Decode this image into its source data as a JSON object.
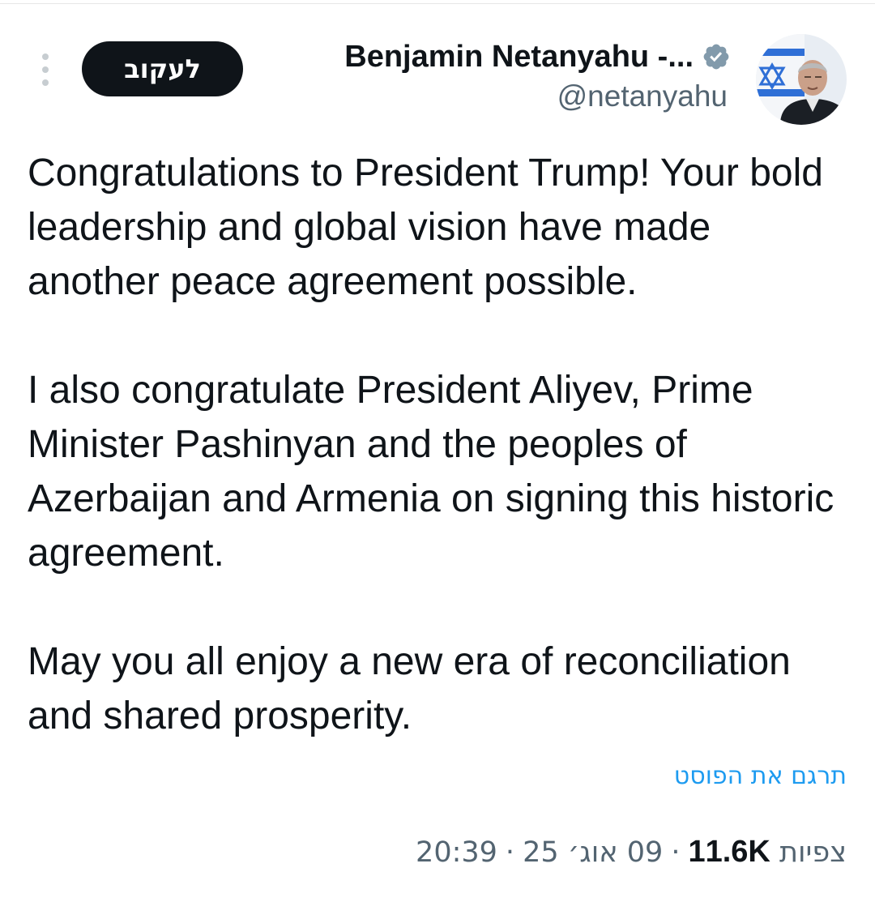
{
  "header": {
    "follow_label": "לעקוב",
    "display_name": "Benjamin Netanyahu -...",
    "handle": "@netanyahu",
    "verified_icon": "verified-badge-icon",
    "more_icon": "more-vertical-icon"
  },
  "tweet": {
    "paragraphs": [
      "Congratulations to President Trump! Your bold leadership and global vision have made another peace agreement possible.",
      "I also congratulate President Aliyev, Prime Minister Pashinyan and the peoples of Azerbaijan and Armenia on signing this historic agreement.",
      "May you all enjoy a new era of reconciliation and shared prosperity."
    ],
    "translate_label": "תרגם את הפוסט"
  },
  "meta": {
    "time": "20:39",
    "date": "09 אוג׳ 25",
    "separator": "·",
    "views_count": "11.6K",
    "views_label": "צפיות"
  },
  "colors": {
    "text": "#0f1419",
    "secondary": "#536471",
    "link": "#1d9bf0",
    "verified": "#829aab"
  }
}
